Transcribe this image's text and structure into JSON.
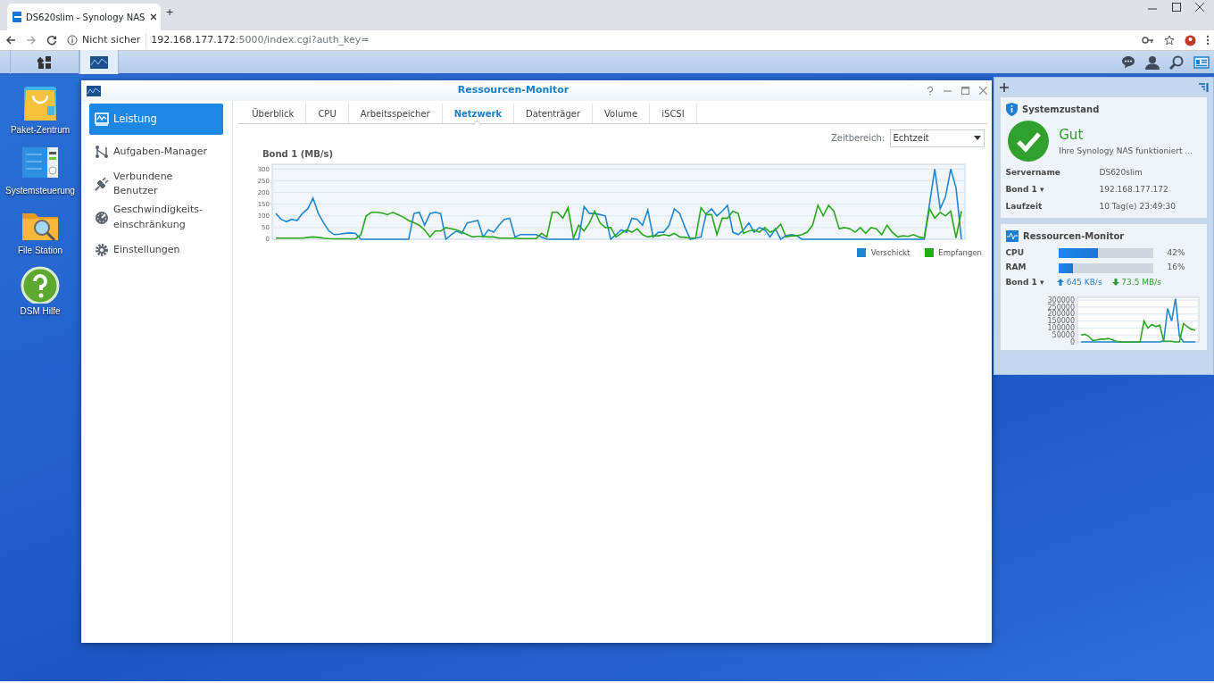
{
  "browser": {
    "tab_title": "DS620slim - Synology NAS",
    "new_tab": "+",
    "security": "Nicht sicher",
    "host": "192.168.177.172",
    "path": ":5000/index.cgi?auth_key="
  },
  "taskbar": {
    "items": [
      {
        "kind": "main-menu",
        "selected": false
      },
      {
        "kind": "resource-monitor",
        "selected": true
      }
    ]
  },
  "desktop_icons": [
    {
      "kind": "package",
      "label": "Paket-Zentrum"
    },
    {
      "kind": "control",
      "label": "Systemsteuerung"
    },
    {
      "kind": "folder",
      "label": "File Station"
    },
    {
      "kind": "help",
      "label": "DSM Hilfe"
    }
  ],
  "window": {
    "title": "Ressourcen-Monitor",
    "sidebar": [
      {
        "kind": "performance",
        "label": "Leistung",
        "selected": true
      },
      {
        "kind": "tasks",
        "label": "Aufgaben-Manager",
        "selected": false
      },
      {
        "kind": "plug",
        "label": "Verbundene Benutzer",
        "selected": false
      },
      {
        "kind": "gauge",
        "label": "Geschwindigkeits-einschränkung",
        "selected": false
      },
      {
        "kind": "gear",
        "label": "Einstellungen",
        "selected": false
      }
    ],
    "tabs": [
      {
        "label": "Überblick",
        "selected": false
      },
      {
        "label": "CPU",
        "selected": false
      },
      {
        "label": "Arbeitsspeicher",
        "selected": false
      },
      {
        "label": "Netzwerk",
        "selected": true
      },
      {
        "label": "Datenträger",
        "selected": false
      },
      {
        "label": "Volume",
        "selected": false
      },
      {
        "label": "iSCSI",
        "selected": false
      }
    ],
    "time_range": {
      "label": "Zeitbereich:",
      "value": "Echtzeit"
    },
    "chart_data": {
      "type": "line",
      "title": "Bond 1 (MB/s)",
      "grid": true,
      "ylim": [
        0,
        320
      ],
      "yticks": [
        0,
        50,
        100,
        150,
        200,
        250,
        300
      ],
      "series": [
        {
          "name": "Verschickt",
          "color": "#1f86d1",
          "values": [
            110,
            85,
            75,
            85,
            80,
            110,
            130,
            175,
            110,
            70,
            35,
            20,
            22,
            25,
            27,
            25,
            0,
            0,
            0,
            0,
            0,
            0,
            0,
            0,
            0,
            0,
            110,
            115,
            60,
            110,
            115,
            110,
            0,
            20,
            35,
            25,
            70,
            75,
            80,
            10,
            40,
            30,
            60,
            85,
            90,
            10,
            20,
            20,
            20,
            20,
            10,
            0,
            0,
            0,
            0,
            0,
            0,
            0,
            140,
            110,
            110,
            105,
            100,
            0,
            20,
            40,
            30,
            90,
            85,
            60,
            125,
            10,
            30,
            30,
            60,
            130,
            110,
            50,
            0,
            5,
            10,
            110,
            130,
            100,
            120,
            145,
            30,
            20,
            40,
            70,
            30,
            50,
            40,
            10,
            45,
            0,
            15,
            20,
            15,
            0,
            0,
            0,
            0,
            0,
            0,
            0,
            0,
            0,
            0,
            0,
            0,
            0,
            0,
            0,
            0,
            0,
            0,
            0,
            0,
            0,
            0,
            0,
            0,
            150,
            300,
            130,
            180,
            300,
            220,
            0
          ]
        },
        {
          "name": "Empfangen",
          "color": "#28a81e",
          "values": [
            5,
            5,
            5,
            5,
            5,
            5,
            8,
            10,
            8,
            5,
            3,
            2,
            2,
            2,
            2,
            2,
            20,
            100,
            115,
            115,
            112,
            105,
            115,
            105,
            95,
            80,
            70,
            60,
            40,
            10,
            35,
            35,
            50,
            45,
            40,
            30,
            20,
            10,
            12,
            12,
            10,
            10,
            5,
            5,
            5,
            5,
            3,
            3,
            3,
            3,
            25,
            10,
            115,
            115,
            90,
            135,
            5,
            60,
            35,
            70,
            120,
            70,
            50,
            50,
            10,
            25,
            40,
            30,
            45,
            20,
            10,
            15,
            15,
            20,
            15,
            25,
            10,
            8,
            5,
            5,
            135,
            105,
            105,
            20,
            90,
            90,
            120,
            110,
            25,
            35,
            40,
            30,
            50,
            30,
            40,
            65,
            10,
            15,
            15,
            20,
            30,
            60,
            145,
            100,
            145,
            120,
            45,
            50,
            45,
            30,
            50,
            25,
            50,
            45,
            20,
            60,
            30,
            10,
            15,
            12,
            20,
            10,
            5,
            130,
            90,
            115,
            100,
            120,
            5,
            120
          ]
        }
      ]
    }
  },
  "widgets": {
    "system_health": {
      "title": "Systemzustand",
      "status": "Gut",
      "message": "Ihre Synology NAS funktioniert ...",
      "rows": [
        {
          "label": "Servername",
          "value": "DS620slim"
        },
        {
          "label": "Bond 1",
          "caret": "▾",
          "value": "192.168.177.172"
        },
        {
          "label": "Laufzeit",
          "value": "10 Tag(e) 23:49:30"
        }
      ]
    },
    "resource_monitor": {
      "title": "Ressourcen-Monitor",
      "meters": [
        {
          "label": "CPU",
          "level": 0.42,
          "reading": "42%"
        },
        {
          "label": "RAM",
          "level": 0.16,
          "reading": "16%"
        }
      ],
      "network": {
        "label": "Bond 1",
        "caret": "▾",
        "upload": "645 KB/s",
        "download": "73.5 MB/s"
      },
      "chart_data": {
        "type": "line",
        "grid": true,
        "ylim": [
          0,
          320000
        ],
        "yticks": [
          0,
          50000,
          100000,
          150000,
          200000,
          250000,
          300000
        ],
        "series": [
          {
            "color": "#1f86d1",
            "values": [
              0,
              0,
              0,
              0,
              0,
              0,
              0,
              0,
              0,
              0,
              0,
              0,
              0,
              0,
              0,
              0,
              0,
              0,
              0,
              0,
              0,
              10000,
              240000,
              150000,
              310000,
              40000,
              0,
              0,
              0,
              0
            ]
          },
          {
            "color": "#28a81e",
            "values": [
              50000,
              55000,
              40000,
              10000,
              15000,
              20000,
              20000,
              25000,
              15000,
              5000,
              0,
              0,
              0,
              0,
              0,
              0,
              150000,
              100000,
              125000,
              110000,
              120000,
              5000,
              5000,
              5000,
              0,
              0,
              130000,
              110000,
              90000,
              85000
            ]
          }
        ]
      }
    }
  }
}
